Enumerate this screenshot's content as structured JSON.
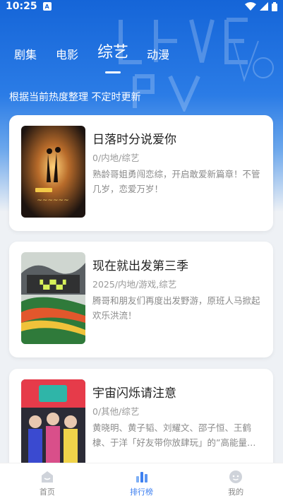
{
  "status_bar": {
    "time": "10:25",
    "app_badge": "A"
  },
  "tabs": [
    {
      "label": "剧集",
      "active": false
    },
    {
      "label": "电影",
      "active": false
    },
    {
      "label": "综艺",
      "active": true
    },
    {
      "label": "动漫",
      "active": false
    }
  ],
  "subtitle": "根据当前热度整理 不定时更新",
  "items": [
    {
      "title": "日落时分说爱你",
      "meta": "0/内地/综艺",
      "desc": "熟龄哥姐勇闯恋综，开启敢爱新篇章！不管几岁，恋爱万岁！"
    },
    {
      "title": "现在就出发第三季",
      "meta": "2025/内地/游戏,综艺",
      "desc": "腾哥和朋友们再度出发野游，原班人马掀起欢乐洪流！"
    },
    {
      "title": "宇宙闪烁请注意",
      "meta": "0/其他/综艺",
      "desc": "黄晓明、黄子韬、刘耀文、邵子恒、王鹤棣、于洋「好友带你放肆玩」的”高能量…"
    }
  ],
  "bottom_nav": [
    {
      "label": "首页",
      "icon": "home-icon",
      "active": false
    },
    {
      "label": "排行榜",
      "icon": "rank-icon",
      "active": true
    },
    {
      "label": "我的",
      "icon": "profile-icon",
      "active": false
    }
  ],
  "colors": {
    "accent": "#3d7ff0",
    "hero_top": "#1565d8"
  }
}
